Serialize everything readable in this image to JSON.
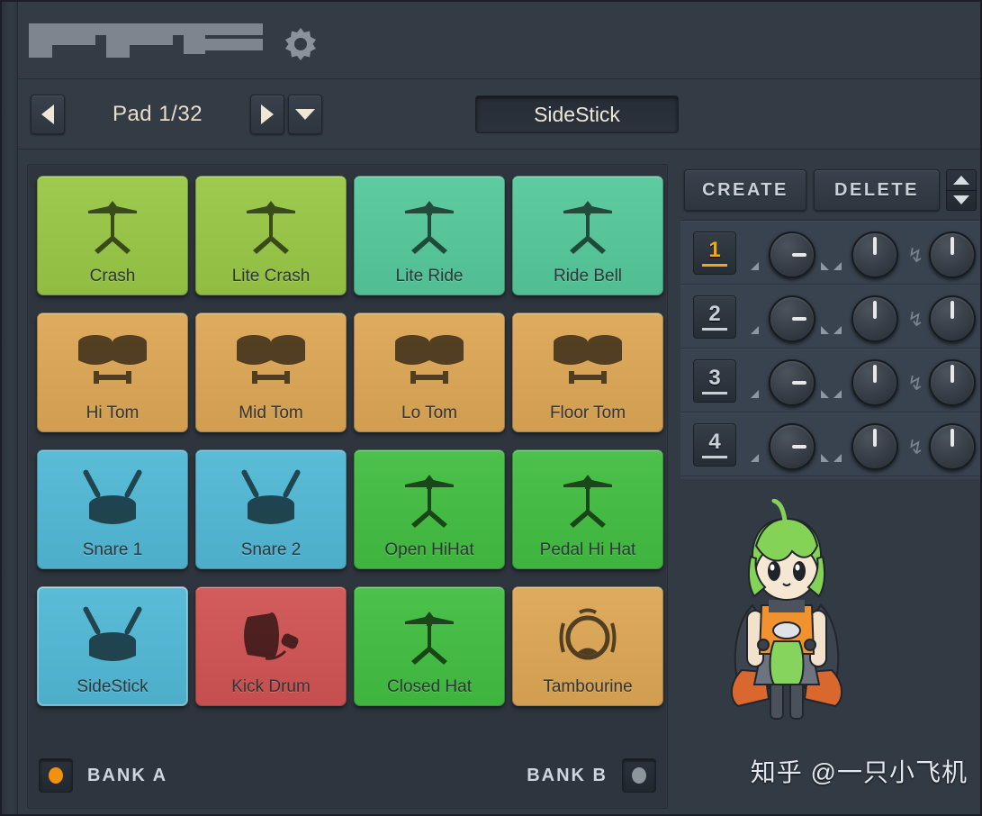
{
  "app": {
    "title": "FPC",
    "logo_text": "FPC"
  },
  "header": {
    "gear_icon": "gear-icon"
  },
  "nav": {
    "prev_icon": "triangle-left-icon",
    "next_icon": "triangle-right-icon",
    "dropdown_icon": "triangle-down-icon",
    "pad_label": "Pad 1/32",
    "selected_pad_name": "SideStick"
  },
  "header_controls": {
    "knobs": [
      {
        "name": "volume-knob",
        "angle": 150
      },
      {
        "name": "pan-knob",
        "angle": 0
      },
      {
        "name": "pitch-knob",
        "angle": 0
      }
    ],
    "markers": [
      "ramp-up-marker",
      "ramp-down-marker"
    ],
    "tuning_icon": "tuning-fork-icon",
    "led_button": {
      "name": "mute-led-button",
      "color": "#c6bdae"
    }
  },
  "pads": [
    {
      "label": "Crash",
      "icon": "cymbal-icon",
      "color": "#9ecb4f",
      "selected": false
    },
    {
      "label": "Lite Crash",
      "icon": "cymbal-icon",
      "color": "#9ecb4f",
      "selected": false
    },
    {
      "label": "Lite Ride",
      "icon": "cymbal-icon",
      "color": "#5ecba0",
      "selected": false
    },
    {
      "label": "Ride Bell",
      "icon": "cymbal-icon",
      "color": "#5ecba0",
      "selected": false
    },
    {
      "label": "Hi Tom",
      "icon": "toms-icon",
      "color": "#dfab5f",
      "selected": false
    },
    {
      "label": "Mid Tom",
      "icon": "toms-icon",
      "color": "#dfab5f",
      "selected": false
    },
    {
      "label": "Lo Tom",
      "icon": "toms-icon",
      "color": "#dfab5f",
      "selected": false
    },
    {
      "label": "Floor Tom",
      "icon": "toms-icon",
      "color": "#dfab5f",
      "selected": false
    },
    {
      "label": "Snare 1",
      "icon": "snare-icon",
      "color": "#5bbcd8",
      "selected": false
    },
    {
      "label": "Snare 2",
      "icon": "snare-icon",
      "color": "#5bbcd8",
      "selected": false
    },
    {
      "label": "Open HiHat",
      "icon": "cymbal-icon",
      "color": "#4cc24c",
      "selected": false
    },
    {
      "label": "Pedal Hi Hat",
      "icon": "cymbal-icon",
      "color": "#4cc24c",
      "selected": false
    },
    {
      "label": "SideStick",
      "icon": "snare-icon",
      "color": "#5bbcd8",
      "selected": true
    },
    {
      "label": "Kick Drum",
      "icon": "kick-drum-icon",
      "color": "#d35c5c",
      "selected": false
    },
    {
      "label": "Closed Hat",
      "icon": "cymbal-icon",
      "color": "#4cc24c",
      "selected": false
    },
    {
      "label": "Tambourine",
      "icon": "tambourine-icon",
      "color": "#dfab5f",
      "selected": false
    }
  ],
  "banks": {
    "a_label": "BANK A",
    "b_label": "BANK B",
    "active": "BANK A",
    "active_led_color": "#f0920f",
    "inactive_led_color": "#8d959d"
  },
  "right_panel": {
    "create_label": "CREATE",
    "delete_label": "DELETE",
    "spinner_up_icon": "triangle-up-icon",
    "spinner_down_icon": "triangle-down-icon",
    "layers": [
      {
        "number": "1",
        "selected": true,
        "color": "#f0a818"
      },
      {
        "number": "2",
        "selected": false,
        "color": "#c9d0d8"
      },
      {
        "number": "3",
        "selected": false,
        "color": "#c9d0d8"
      },
      {
        "number": "4",
        "selected": false,
        "color": "#c9d0d8"
      }
    ],
    "layer_knobs": [
      "pan-knob",
      "volume-knob",
      "pitch-knob"
    ],
    "tuning_icon": "tuning-fork-icon"
  },
  "mascot": {
    "name": "anime-chibi-mascot"
  },
  "watermark": {
    "text": "知乎 @一只小飞机"
  },
  "colors": {
    "panel_bg": "#323a44",
    "pad_panel_bg": "#2e353e",
    "layer_list_bg": "#39434f",
    "accent": "#f0a818"
  }
}
